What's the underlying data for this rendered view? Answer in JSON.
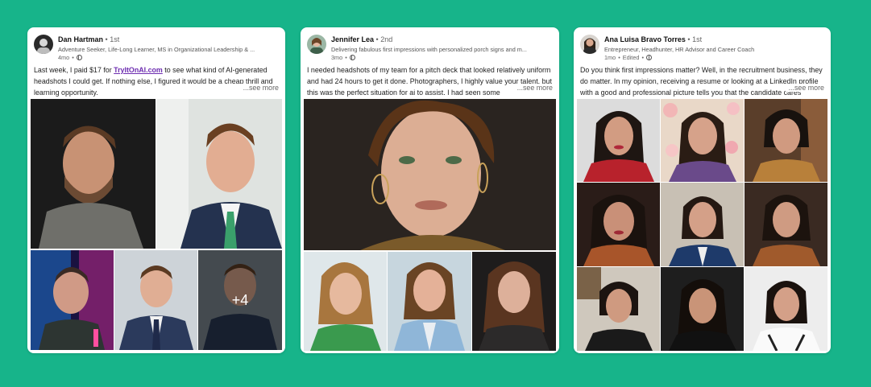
{
  "posts": [
    {
      "author": "Dan Hartman",
      "degree": "1st",
      "tagline": "Adventure Seeker, Life-Long Learner, MS in Organizational Leadership & ...",
      "time": "4mo",
      "text_before_link": "Last week, I paid $17 for ",
      "link_text": "TryItOnAI.com",
      "text_after_link": " to see what kind of AI-generated headshots I could get. If nothing else, I figured it would be a cheap thrill and learning opportunity.",
      "see_more": "...see more",
      "more_photos_label": "+4"
    },
    {
      "author": "Jennifer Lea",
      "degree": "2nd",
      "tagline": "Delivering fabulous first impressions with personalized porch signs and m...",
      "time": "3mo",
      "text": "I needed headshots of my team for a pitch deck that looked relatively uniform and had 24 hours to get it done. Photographers, I highly value your talent, but this was the perfect situation for ai to assist. I had seen some",
      "see_more": "...see more"
    },
    {
      "author": "Ana Luisa Bravo Torres",
      "degree": "1st",
      "tagline": "Entrepreneur, Headhunter, HR Advisor and Career Coach",
      "time": "1mo",
      "edited": "Edited",
      "text": "Do you think first impressions matter? Well, in the recruitment business, they do matter. In my opinion, receiving a resume or looking at a LinkedIn profile with a good and professional picture tells you that the candidate cares",
      "see_more": "...see more"
    }
  ],
  "separator": "•",
  "icons": {
    "visibility": "globe-icon"
  },
  "colors": {
    "background": "#17b48a",
    "link": "#6d2db0",
    "card": "#ffffff"
  }
}
